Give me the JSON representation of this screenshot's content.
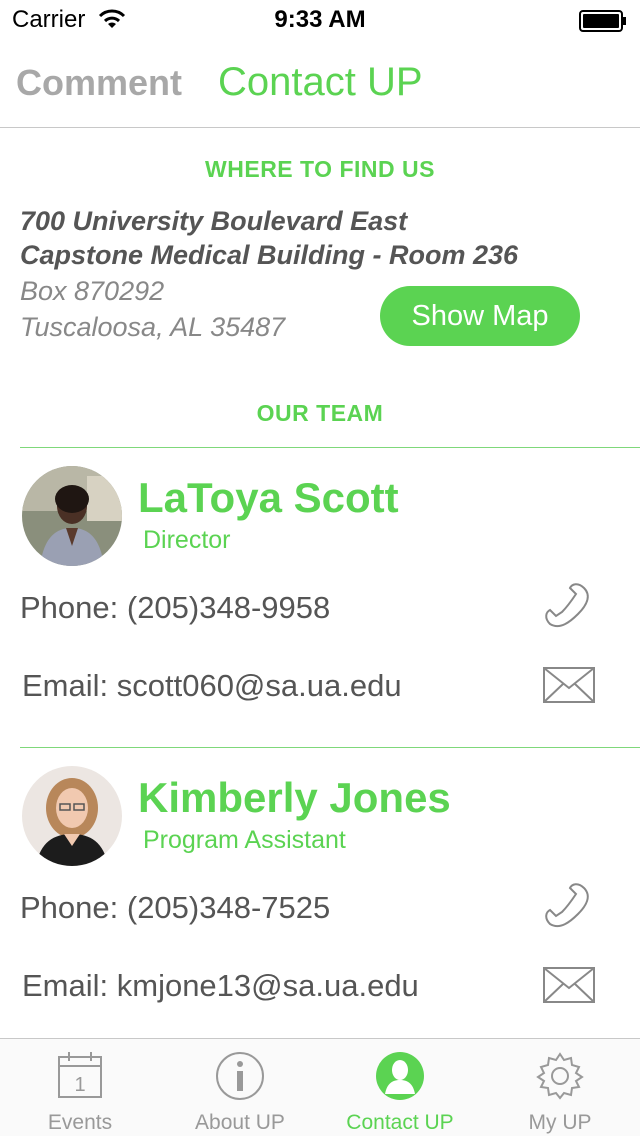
{
  "status_bar": {
    "carrier": "Carrier",
    "time": "9:33 AM"
  },
  "top_nav": {
    "comment_tab": "Comment",
    "contact_tab": "Contact UP"
  },
  "location": {
    "heading": "WHERE TO FIND US",
    "address_line1": "700 University Boulevard East",
    "address_line2": "Capstone Medical Building - Room 236",
    "address_line3": "Box 870292",
    "address_line4": "Tuscaloosa, AL 35487",
    "show_map_label": "Show Map"
  },
  "team": {
    "heading": "OUR TEAM",
    "members": [
      {
        "name": "LaToya Scott",
        "role": "Director",
        "phone": "Phone: (205)348-9958",
        "email": "Email: scott060@sa.ua.edu"
      },
      {
        "name": "Kimberly Jones",
        "role": "Program Assistant",
        "phone": "Phone: (205)348-7525",
        "email": "Email: kmjone13@sa.ua.edu"
      }
    ]
  },
  "tab_bar": {
    "items": [
      {
        "label": "Events",
        "icon": "calendar-icon",
        "calendar_day": "1"
      },
      {
        "label": "About UP",
        "icon": "info-icon"
      },
      {
        "label": "Contact UP",
        "icon": "person-icon"
      },
      {
        "label": "My UP",
        "icon": "gear-icon"
      }
    ],
    "active": "Contact UP"
  },
  "colors": {
    "accent": "#5bd352",
    "muted": "#a8a8a8",
    "text": "#555555"
  }
}
